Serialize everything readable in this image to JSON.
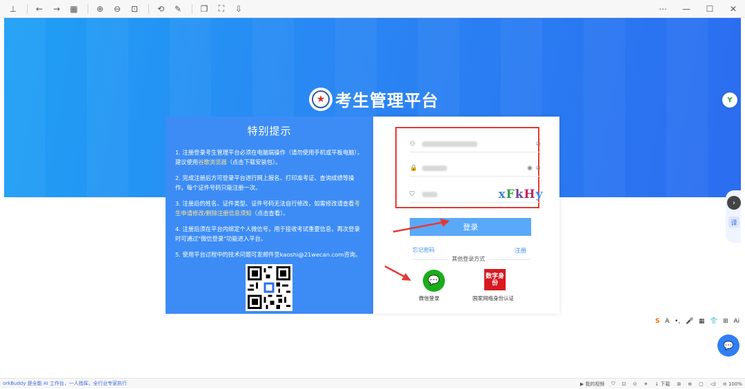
{
  "toolbar": {
    "icons": [
      "pin-icon",
      "back-icon",
      "forward-icon",
      "grid-icon",
      "zoom-in-icon",
      "zoom-out-icon",
      "fit-icon",
      "rotate-icon",
      "edit-icon",
      "copy-icon",
      "screenshot-icon",
      "download-icon"
    ],
    "more": "⋯",
    "minimize": "—",
    "maximize": "☐",
    "close": "✕"
  },
  "hero": {
    "title": "考生管理平台"
  },
  "notice": {
    "title": "特别提示",
    "items": [
      {
        "before": "1. 注册登录考生管理平台必须在电脑端操作（请勿使用手机或平板电脑），建议使用",
        "link": "谷歌浏览器",
        "after": "（点击下载安装包）。"
      },
      {
        "before": "2. 完成注册后方可登录平台进行网上报名、打印准考证、查询成绩等操作，每个证件号码只能注册一次。",
        "link": "",
        "after": ""
      },
      {
        "before": "3. 注册后的姓名、证件类型、证件号码无法自行修改，如需修改请查看",
        "link": "考生申请修改/删除注册信息须知",
        "after": "（点击查看）。"
      },
      {
        "before": "4. 注册后须在平台内绑定个人微信号，用于接收考试重要信息，再次登录时可通过\"微信登录\"功能进入平台。",
        "link": "",
        "after": ""
      },
      {
        "before": "5. 使用平台过程中的技术问题可发邮件至kaoshi@21wecan.com咨询。",
        "link": "",
        "after": ""
      }
    ]
  },
  "login": {
    "captcha_text": "xFkHy",
    "login_button": "登录",
    "forgot": "忘记密码",
    "register": "注册",
    "other_methods": "其他登录方式",
    "wechat_label": "微信登录",
    "id_icon_text": "数字身份",
    "id_label": "国家网络身份认证"
  },
  "side": {
    "translate": "译",
    "ime_items": [
      "S",
      "A",
      "•,",
      "🎤",
      "▦",
      "👕",
      "⊞",
      "Ai"
    ]
  },
  "statusbar": {
    "left_text": "orkBuddy 是全能 AI 工作台，一人指挥，全行业专家执行",
    "right_items": [
      "▶ 我的视频",
      "⛉",
      "⊡",
      "⊙",
      "✈",
      "↓ 下载",
      "⊞",
      "⊕",
      "▢",
      "◁)",
      "⊖ 100%"
    ]
  },
  "colors": {
    "hero_start": "#1fa0f5",
    "hero_end": "#2b6df0",
    "notice_bg": "#3d8cf5",
    "login_button": "#5aa8f8",
    "highlight_red": "#e53935",
    "wechat_green": "#1aad19",
    "id_red": "#d71920"
  }
}
